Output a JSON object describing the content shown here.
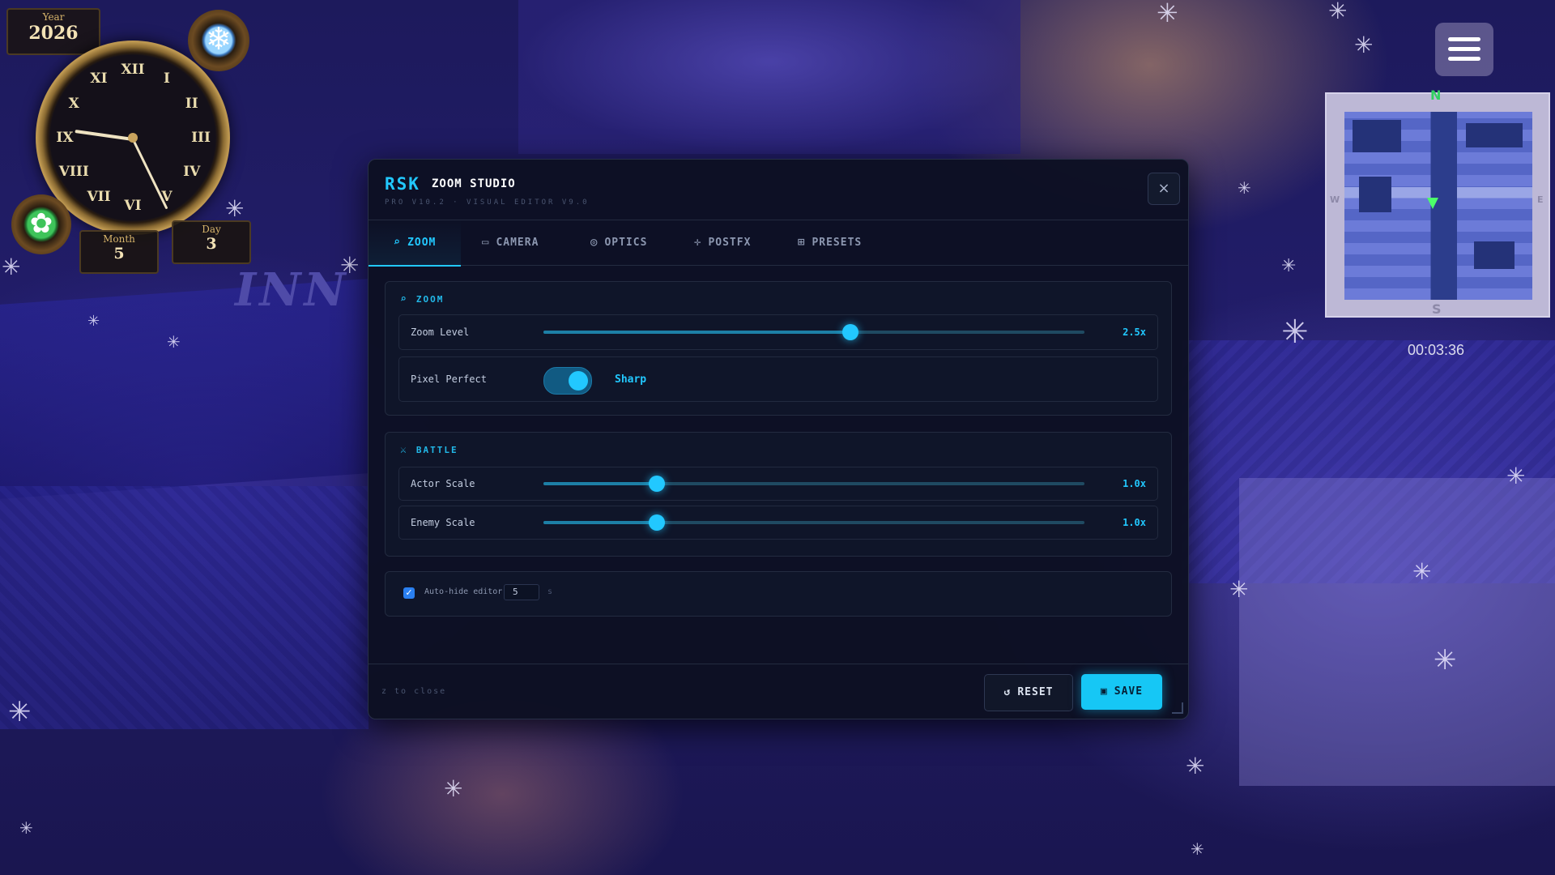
{
  "hud": {
    "year_label": "Year",
    "year": "2026",
    "month_label": "Month",
    "month": "5",
    "day_label": "Day",
    "day": "3",
    "clock_numerals": [
      "XII",
      "I",
      "II",
      "III",
      "IV",
      "V",
      "VI",
      "VII",
      "VIII",
      "IX",
      "X",
      "XI"
    ],
    "season_icon": "snowflake-icon",
    "weather_icon": "star-icon",
    "play_time": "00:03:36"
  },
  "map": {
    "sign_text": "INN"
  },
  "minimap": {
    "north": "N",
    "south": "S",
    "west": "W",
    "east": "E"
  },
  "editor": {
    "brand": "RSK",
    "title": "ZOOM STUDIO",
    "version": "PRO V10.2 · VISUAL EDITOR V9.0",
    "close_label": "×",
    "tabs": [
      {
        "label": "ZOOM",
        "icon": "magnifier-icon",
        "active": true
      },
      {
        "label": "CAMERA",
        "icon": "camera-icon",
        "active": false
      },
      {
        "label": "OPTICS",
        "icon": "lens-icon",
        "active": false
      },
      {
        "label": "POSTFX",
        "icon": "crosshair-icon",
        "active": false
      },
      {
        "label": "PRESETS",
        "icon": "grid-icon",
        "active": false
      }
    ],
    "zoom_section": {
      "title": "ZOOM",
      "zoom_level": {
        "label": "Zoom Level",
        "value": "2.5x",
        "fraction": 0.568
      },
      "pixel_perfect": {
        "label": "Pixel Perfect",
        "on": true,
        "state_text": "Sharp"
      }
    },
    "battle_section": {
      "title": "BATTLE",
      "actor_scale": {
        "label": "Actor Scale",
        "value": "1.0x",
        "fraction": 0.21
      },
      "enemy_scale": {
        "label": "Enemy Scale",
        "value": "1.0x",
        "fraction": 0.21
      }
    },
    "autohide": {
      "checked": true,
      "label": "Auto-hide editor",
      "value": "5",
      "unit": "s"
    },
    "footer": {
      "hint": "z to close",
      "reset_label": "RESET",
      "save_label": "SAVE"
    }
  },
  "colors": {
    "accent": "#22c8ff",
    "save_button": "#16c7f5",
    "panel_bg": "#0c1022"
  }
}
